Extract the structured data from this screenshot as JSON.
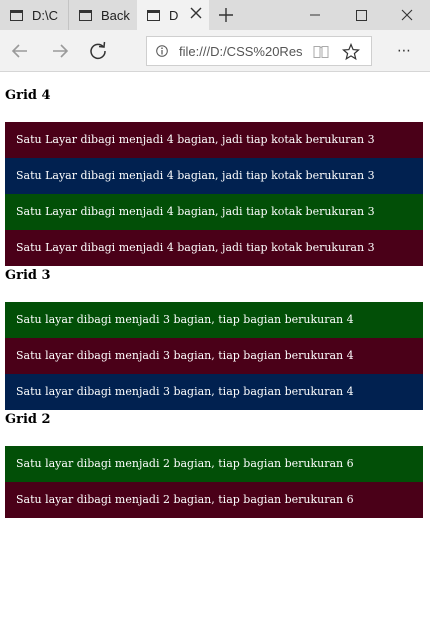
{
  "browser": {
    "tabs": [
      {
        "label": "D:\\C"
      },
      {
        "label": "Back"
      },
      {
        "label": "D"
      }
    ],
    "url": "file:///D:/CSS%20Res"
  },
  "colors": {
    "maroon": "#4a0018",
    "navy": "#012150",
    "green": "#024f07"
  },
  "sections": [
    {
      "heading": "Grid 4",
      "boxes": [
        {
          "text": "Satu Layar dibagi menjadi 4 bagian, jadi tiap kotak berukuran 3",
          "color": "#4a0018"
        },
        {
          "text": "Satu Layar dibagi menjadi 4 bagian, jadi tiap kotak berukuran 3",
          "color": "#012150"
        },
        {
          "text": "Satu Layar dibagi menjadi 4 bagian, jadi tiap kotak berukuran 3",
          "color": "#024f07"
        },
        {
          "text": "Satu Layar dibagi menjadi 4 bagian, jadi tiap kotak berukuran 3",
          "color": "#4a0018"
        }
      ]
    },
    {
      "heading": "Grid 3",
      "boxes": [
        {
          "text": "Satu layar dibagi menjadi 3 bagian, tiap bagian berukuran 4",
          "color": "#024f07"
        },
        {
          "text": "Satu layar dibagi menjadi 3 bagian, tiap bagian berukuran 4",
          "color": "#4a0018"
        },
        {
          "text": "Satu layar dibagi menjadi 3 bagian, tiap bagian berukuran 4",
          "color": "#012150"
        }
      ]
    },
    {
      "heading": "Grid 2",
      "boxes": [
        {
          "text": "Satu layar dibagi menjadi 2 bagian, tiap bagian berukuran 6",
          "color": "#024f07"
        },
        {
          "text": "Satu layar dibagi menjadi 2 bagian, tiap bagian berukuran 6",
          "color": "#4a0018"
        }
      ]
    }
  ]
}
